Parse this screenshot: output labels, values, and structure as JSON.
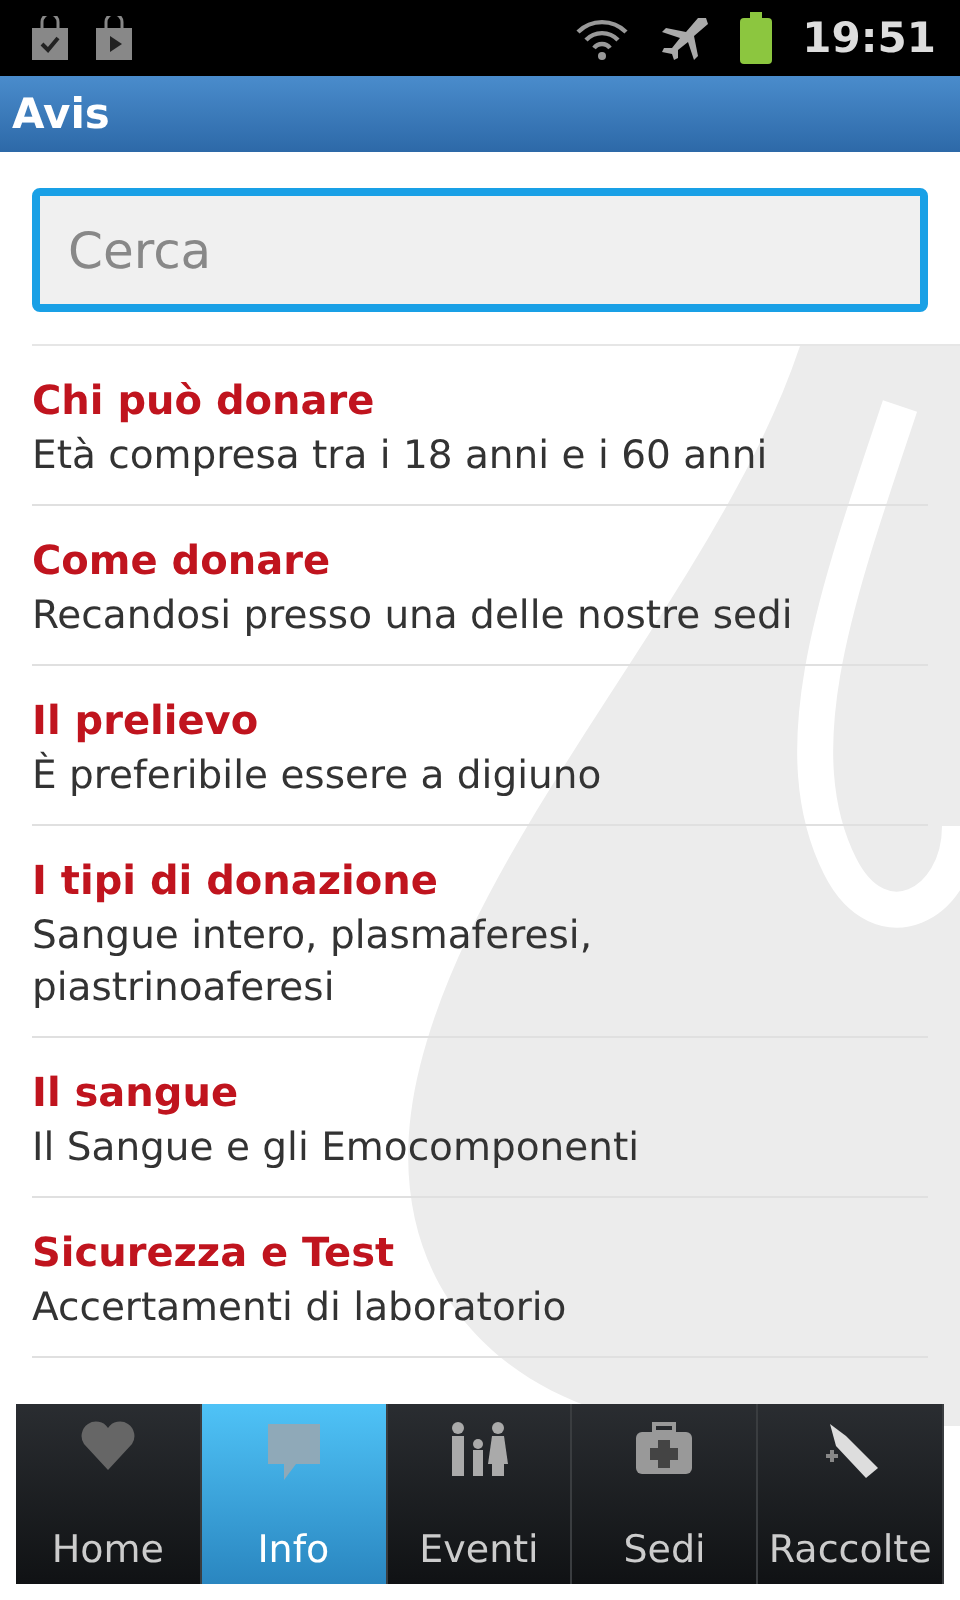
{
  "status_bar": {
    "time": "19:51"
  },
  "window": {
    "title": "Avis"
  },
  "search": {
    "placeholder": "Cerca"
  },
  "items": [
    {
      "title": "Chi può donare",
      "subtitle": "Età compresa tra i 18 anni e i 60 anni"
    },
    {
      "title": "Come donare",
      "subtitle": "Recandosi presso una delle nostre sedi"
    },
    {
      "title": "Il prelievo",
      "subtitle": "È preferibile essere a digiuno"
    },
    {
      "title": "I tipi di donazione",
      "subtitle": "Sangue intero, plasmaferesi, piastrinoaferesi"
    },
    {
      "title": "Il sangue",
      "subtitle": "Il Sangue e gli Emocomponenti"
    },
    {
      "title": "Sicurezza e Test",
      "subtitle": "Accertamenti di laboratorio"
    }
  ],
  "tabs": [
    {
      "label": "Home",
      "kind": "heart",
      "selected": false
    },
    {
      "label": "Info",
      "kind": "chat",
      "selected": true
    },
    {
      "label": "Eventi",
      "kind": "people",
      "selected": false
    },
    {
      "label": "Sedi",
      "kind": "kit",
      "selected": false
    },
    {
      "label": "Raccolte",
      "kind": "tag",
      "selected": false
    }
  ]
}
